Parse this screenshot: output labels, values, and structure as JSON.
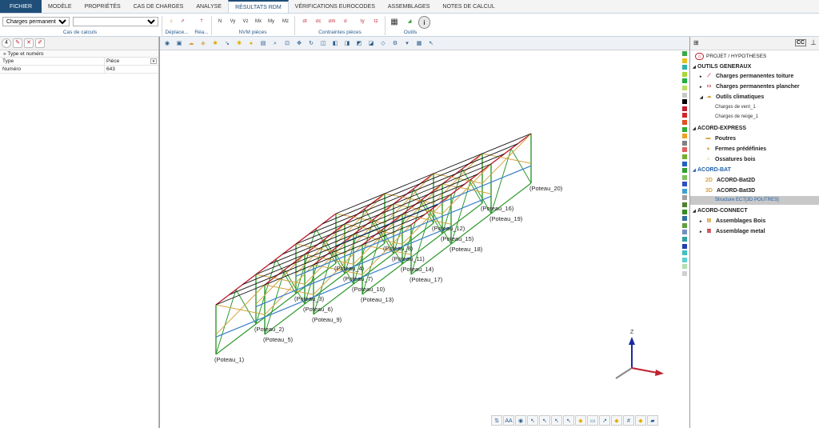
{
  "menu": {
    "file": "FICHIER",
    "items": [
      "MODÈLE",
      "PROPRIÉTÉS",
      "CAS DE CHARGES",
      "ANALYSE",
      "RÉSULTATS RDM",
      "VÉRIFICATIONS EUROCODES",
      "ASSEMBLAGES",
      "NOTES DE CALCUL"
    ],
    "active_index": 4
  },
  "ribbon": {
    "load_case_value": "Charges permanentes",
    "load_case_options": [
      "Charges permanentes"
    ],
    "group_labels": {
      "cases": "Cas de calculs",
      "displacements": "Déplace...",
      "reactions": "Réa...",
      "nvm": "NVM pièces",
      "stresses": "Contraintes pièces",
      "tools": "Outils"
    },
    "nvm_icons": [
      "N",
      "Vy",
      "Vz",
      "Mx",
      "My",
      "Mz"
    ],
    "stress_icons": [
      "σt",
      "σc",
      "σm",
      "σ",
      "τy",
      "τz"
    ]
  },
  "left_panel": {
    "toolbar_badge": "4",
    "group_title": "Type et numéro",
    "rows": [
      {
        "key": "Type",
        "value": "Pièce"
      },
      {
        "key": "Numéro",
        "value": "643"
      }
    ]
  },
  "viewport": {
    "poteaux": [
      "Poteau_1",
      "Poteau_2",
      "Poteau_3",
      "Poteau_4",
      "Poteau_5",
      "Poteau_6",
      "Poteau_7",
      "Poteau_8",
      "Poteau_9",
      "Poteau_10",
      "Poteau_11",
      "Poteau_12",
      "Poteau_13",
      "Poteau_14",
      "Poteau_15",
      "Poteau_16",
      "Poteau_17",
      "Poteau_18",
      "Poteau_19",
      "Poteau_20"
    ],
    "axis_label": "Z",
    "bottom_text": "AA"
  },
  "right_panel": {
    "root": "PROJET / HYPOTHESES",
    "sections": [
      {
        "title": "OUTILS GENERAUX",
        "items": [
          "Charges permanentes toiture",
          "Charges permanentes plancher",
          "Outils climatiques"
        ],
        "subitems": [
          "Charges de vent_1",
          "Charges de neige_1"
        ]
      },
      {
        "title": "ACORD-EXPRESS",
        "items": [
          "Poutres",
          "Fermes prédéfinies",
          "Ossatures bois"
        ]
      },
      {
        "title": "ACORD-BAT",
        "items": [
          "ACORD-Bat2D",
          "ACORD-Bat3D"
        ],
        "selected": "Structure ECT[3D POUTRES]"
      },
      {
        "title": "ACORD-CONNECT",
        "items": [
          "Assemblages Bois",
          "Assemblage metal"
        ]
      }
    ],
    "badge": "CC"
  },
  "colors": {
    "accent": "#1f4e79",
    "truss_green": "#2e9a2e",
    "bracing_tan": "#d4a340",
    "beam_red": "#c02030",
    "beam_blue": "#3a7fc8",
    "purlin_black": "#111111"
  },
  "palette": [
    "#39a845",
    "#e8c020",
    "#30b0b0",
    "#a8d838",
    "#20b040",
    "#b8e060",
    "#c8c8c8",
    "#000000",
    "#c02030",
    "#d02828",
    "#e05020",
    "#30b030",
    "#f0a020",
    "#808080",
    "#e06060",
    "#70b030",
    "#2060c0",
    "#30a030",
    "#80c060",
    "#3050c0",
    "#40a0d0",
    "#a0a0a0",
    "#508030",
    "#309020",
    "#3070a0",
    "#60a040",
    "#7090c0",
    "#30a0a0",
    "#2040b0",
    "#40c0c0",
    "#60d0d0",
    "#b0e0b0",
    "#d0d0d0"
  ]
}
